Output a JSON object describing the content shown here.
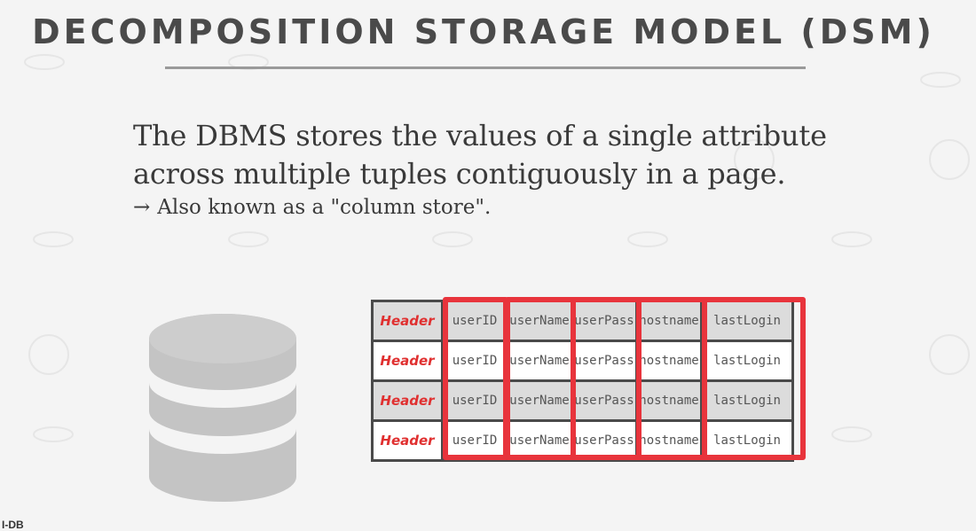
{
  "slide": {
    "title": "DECOMPOSITION STORAGE MODEL (DSM)",
    "paragraph": "The DBMS stores the values of a single attribute across multiple tuples contiguously in a page.",
    "bullet_arrow": "→",
    "bullet": "Also known as a \"column store\".",
    "footer": "I-DB"
  },
  "page_table": {
    "rows": [
      {
        "header": "Header",
        "cells": [
          "userID",
          "userName",
          "userPass",
          "hostname",
          "lastLogin"
        ],
        "shade": "gray"
      },
      {
        "header": "Header",
        "cells": [
          "userID",
          "userName",
          "userPass",
          "hostname",
          "lastLogin"
        ],
        "shade": "white"
      },
      {
        "header": "Header",
        "cells": [
          "userID",
          "userName",
          "userPass",
          "hostname",
          "lastLogin"
        ],
        "shade": "gray"
      },
      {
        "header": "Header",
        "cells": [
          "userID",
          "userName",
          "userPass",
          "hostname",
          "lastLogin"
        ],
        "shade": "white"
      }
    ]
  },
  "colors": {
    "highlight": "#e8343c",
    "header_text": "#e03030",
    "database_icon": "#c4c4c4"
  },
  "icons": [
    "database-icon"
  ]
}
